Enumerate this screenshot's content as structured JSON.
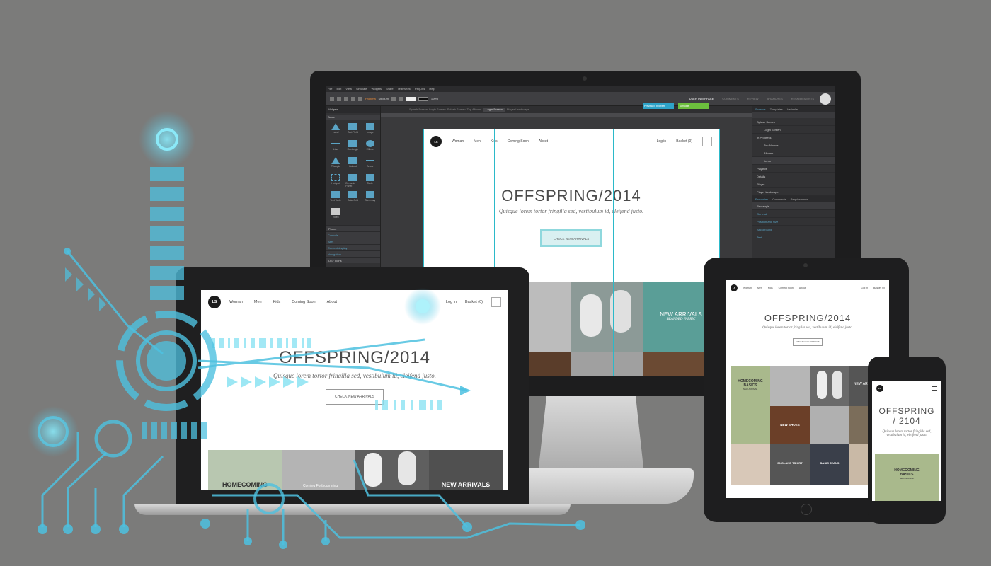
{
  "editor": {
    "menus": [
      "File",
      "Edit",
      "View",
      "Simulate",
      "Widgets",
      "Share",
      "Teamwork",
      "Plug-ins",
      "Help"
    ],
    "toolbar_font": "Proxima",
    "toolbar_weight": "Medium",
    "toolbar_zoom": "100%",
    "tabs": [
      "USER INTERFACE",
      "COMMENTS",
      "REVIEW",
      "BRANCHES",
      "REQUIREMENTS"
    ],
    "canvas_tabs": [
      "Splash Screen",
      "Login Screen",
      "Splash Screen",
      "Top Albums",
      "Login Screen",
      "Player Landscape"
    ],
    "active_canvas_tab": "Login Screen",
    "left_panel": {
      "title": "Widgets",
      "group": "Basic",
      "widgets": [
        "Label",
        "Text Field",
        "Image",
        "Line",
        "Rectangle",
        "Ellipse",
        "Triangle",
        "Callout",
        "Arrow",
        "Hotspot",
        "Dynamic Panel",
        "Table",
        "Text Table",
        "Data Grid",
        "Summary",
        "Video"
      ],
      "sections": [
        "iPhone",
        "Controls",
        "Bars",
        "Content display",
        "Navigation"
      ],
      "footer": "iOS7 Icons"
    },
    "right_panel": {
      "tabs": [
        "Screens",
        "Templates",
        "Variables"
      ],
      "screens": [
        "Splash Screen",
        "Login Screen",
        "In Progress",
        "Top Albums",
        "Albums",
        "Items",
        "Playlists",
        "Details",
        "Player",
        "Player landscape"
      ],
      "prop_tabs": [
        "Properties",
        "Comments",
        "Requirements"
      ],
      "selected": "Rectangle",
      "prop_sections": [
        "General",
        "Position and size",
        "Background",
        "Text"
      ]
    },
    "buttons": {
      "preview": "Preview in browser",
      "simulate": "Simulate"
    }
  },
  "site": {
    "logo": "LS",
    "nav": [
      "Woman",
      "Men",
      "Kids",
      "Coming Soon",
      "About"
    ],
    "login": "Log in",
    "basket": "Basket (0)",
    "title": "OFFSPRING/2014",
    "subtitle": "Quisque lorem tortor fringilla sed, vestibulum id, eleifend justo.",
    "cta": "CHECK NEW ARRIVALS",
    "tiles": {
      "homecoming": "HOMECOMING",
      "homecoming_basics": "BASICS",
      "homecoming_sub": "NEW ARRIVAL",
      "new_arrivals": "NEW ARRIVALS",
      "new_arrivals_sub": "BRANDED FABRIC",
      "new_shoes": "NEW SHOES",
      "england_tshirt": "ENGLAND TSHIRT",
      "basic_jeans": "BASIC JEANS",
      "tweet": "Coming Forthcomning"
    }
  },
  "phone": {
    "title_line1": "OFFSPRING",
    "title_line2": "/ 2104"
  },
  "colors": {
    "background": "#7b7b7a",
    "teal": "#5a9e97",
    "accent": "#35c0d8",
    "circuit": "#4ec1e0"
  }
}
